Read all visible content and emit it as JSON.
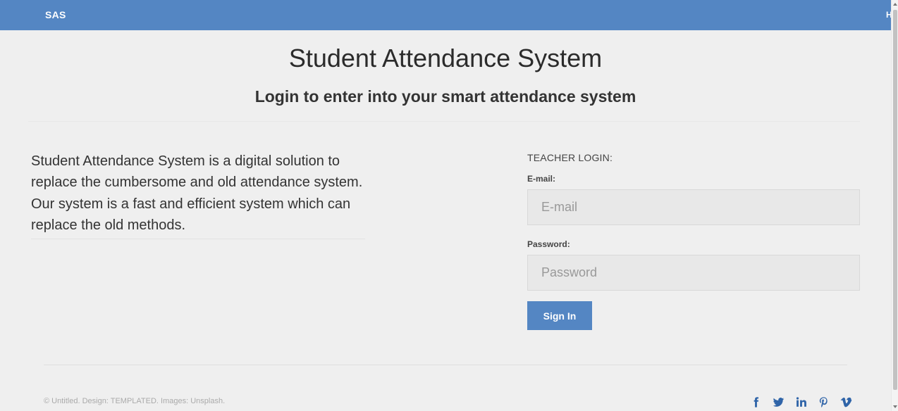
{
  "nav": {
    "brand": "SAS",
    "right_link": "Home"
  },
  "header": {
    "title": "Student Attendance System",
    "subtitle": "Login to enter into your smart attendance system"
  },
  "intro": {
    "text": "Student Attendance System is a digital solution to replace the cumbersome and old attendance system. Our system is a fast and efficient system which can replace the old methods."
  },
  "login": {
    "heading": "TEACHER LOGIN:",
    "email_label": "E-mail:",
    "email_placeholder": "E-mail",
    "email_value": "",
    "password_label": "Password:",
    "password_placeholder": "Password",
    "password_value": "",
    "submit_label": "Sign In"
  },
  "footer": {
    "copyright": "© Untitled. Design: TEMPLATED. Images: Unsplash.",
    "social": [
      "facebook-icon",
      "twitter-icon",
      "linkedin-icon",
      "pinterest-icon",
      "vimeo-icon"
    ]
  },
  "colors": {
    "accent": "#5486c3",
    "background": "#efefef",
    "icon": "#2f64a8"
  }
}
